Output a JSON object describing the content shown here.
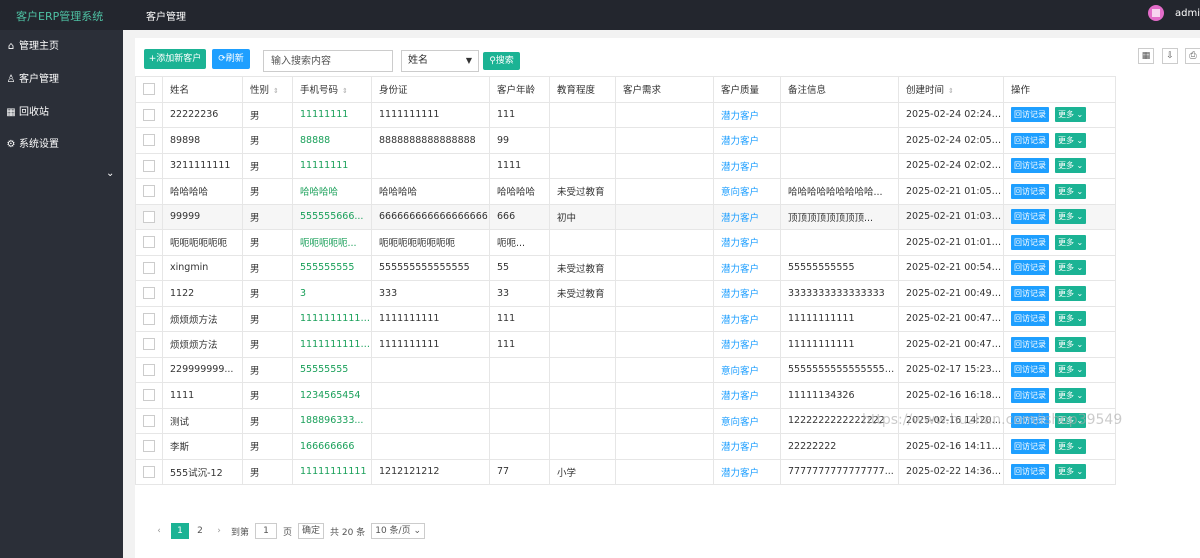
{
  "header": {
    "brand": "客户ERP管理系统",
    "nav": "客户管理",
    "user": "admin"
  },
  "sidebar": {
    "items": [
      {
        "label": "管理主页",
        "icon": "home-icon",
        "glyph": "⌂"
      },
      {
        "label": "客户管理",
        "icon": "user-icon",
        "glyph": "♙"
      },
      {
        "label": "回收站",
        "icon": "trash-icon",
        "glyph": "▦"
      },
      {
        "label": "系统设置",
        "icon": "gear-icon",
        "glyph": "⚙"
      }
    ]
  },
  "toolbar": {
    "add_label": "+添加新客户",
    "refresh_label": "⟳刷新",
    "search_placeholder": "输入搜索内容",
    "search_field": "姓名",
    "search_label": "⚲搜索",
    "tool_icons": [
      "▦",
      "⇩",
      "⎙"
    ]
  },
  "table": {
    "columns": [
      "姓名",
      "性别",
      "手机号码",
      "身份证",
      "客户年龄",
      "教育程度",
      "客户需求",
      "客户质量",
      "备注信息",
      "创建时间",
      "操作"
    ],
    "action_visit": "回访记录",
    "action_more": "更多 ⌄",
    "rows": [
      [
        "22222236",
        "男",
        "11111111",
        "1111111111",
        "111",
        "",
        "",
        "潜力客户",
        "",
        "2025-02-24 02:24:02"
      ],
      [
        "89898",
        "男",
        "88888",
        "8888888888888888",
        "99",
        "",
        "",
        "潜力客户",
        "",
        "2025-02-24 02:05:03"
      ],
      [
        "3211111111",
        "男",
        "11111111",
        "",
        "1111",
        "",
        "",
        "潜力客户",
        "",
        "2025-02-24 02:02:38"
      ],
      [
        "哈哈哈哈",
        "男",
        "哈哈哈哈",
        "哈哈哈哈",
        "哈哈哈哈",
        "未受过教育",
        "",
        "意向客户",
        "哈哈哈哈哈哈哈哈哈...",
        "2025-02-21 01:05:03"
      ],
      [
        "99999",
        "男",
        "555555666...",
        "666666666666666666",
        "666",
        "初中",
        "",
        "潜力客户",
        "顶顶顶顶顶顶顶顶...",
        "2025-02-21 01:03:12"
      ],
      [
        "呃呃呃呃呃呃",
        "男",
        "呃呃呃呃呃...",
        "呃呃呃呃呃呃呃呃",
        "呃呃...",
        "",
        "",
        "潜力客户",
        "",
        "2025-02-21 01:01:26"
      ],
      [
        "xingmin",
        "男",
        "555555555",
        "555555555555555",
        "55",
        "未受过教育",
        "",
        "潜力客户",
        "55555555555",
        "2025-02-21 00:54:06"
      ],
      [
        "1122",
        "男",
        "3",
        "333",
        "33",
        "未受过教育",
        "",
        "潜力客户",
        "3333333333333333",
        "2025-02-21 00:49:29"
      ],
      [
        "烦烦烦方法",
        "男",
        "111111111111...",
        "1111111111",
        "111",
        "",
        "",
        "潜力客户",
        "11111111111",
        "2025-02-21 00:47:11"
      ],
      [
        "烦烦烦方法",
        "男",
        "111111111111...",
        "1111111111",
        "111",
        "",
        "",
        "潜力客户",
        "11111111111",
        "2025-02-21 00:47:10"
      ],
      [
        "229999999...",
        "男",
        "55555555",
        "",
        "",
        "",
        "",
        "意向客户",
        "5555555555555555555",
        "2025-02-17 15:23:24"
      ],
      [
        "1111",
        "男",
        "1234565454",
        "",
        "",
        "",
        "",
        "潜力客户",
        "11111134326",
        "2025-02-16 16:18:47"
      ],
      [
        "测试",
        "男",
        "188896333...",
        "",
        "",
        "",
        "",
        "意向客户",
        "1222222222222222",
        "2025-02-16 14:20:33"
      ],
      [
        "李斯",
        "男",
        "166666666",
        "",
        "",
        "",
        "",
        "潜力客户",
        "22222222",
        "2025-02-16 14:11:38"
      ],
      [
        "555试沉-12",
        "男",
        "11111111111",
        "1212121212",
        "77",
        "小学",
        "",
        "潜力客户",
        "7777777777777777...",
        "2025-02-22 14:36:06"
      ]
    ]
  },
  "pagination": {
    "prev": "‹",
    "current": "1",
    "next_page": "2",
    "next": "›",
    "goto_label": "到第",
    "goto_value": "1",
    "page_unit": "页",
    "confirm": "确定",
    "total": "共 20 条",
    "page_size": "10 条/页 ⌄"
  },
  "watermark": "https://www.huzhan.com/ishop39549"
}
